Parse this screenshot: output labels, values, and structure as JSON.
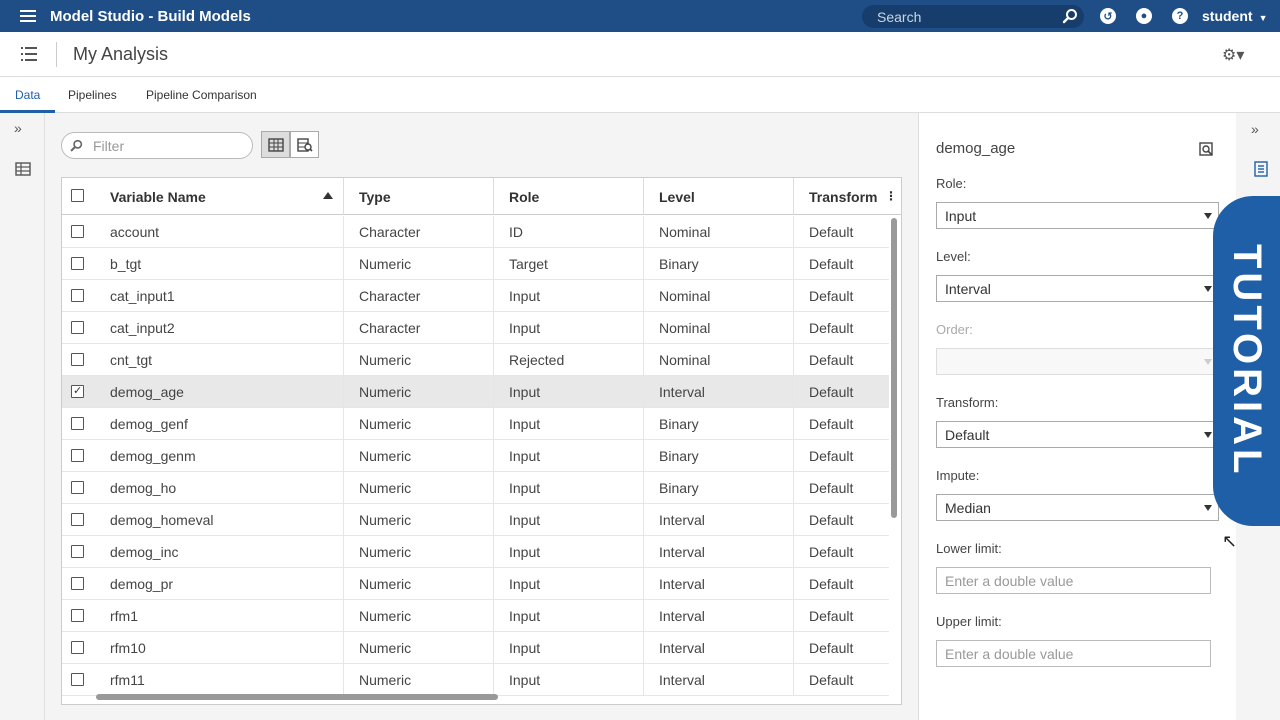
{
  "topbar": {
    "app_title": "Model Studio - Build Models",
    "search_placeholder": "Search",
    "user": "student"
  },
  "subbar": {
    "analysis_title": "My Analysis"
  },
  "tabs": [
    {
      "label": "Data"
    },
    {
      "label": "Pipelines"
    },
    {
      "label": "Pipeline Comparison"
    }
  ],
  "filter": {
    "placeholder": "Filter"
  },
  "table": {
    "columns": [
      "Variable Name",
      "Type",
      "Role",
      "Level",
      "Transform"
    ],
    "rows": [
      {
        "name": "account",
        "type": "Character",
        "role": "ID",
        "level": "Nominal",
        "transform": "Default",
        "checked": false
      },
      {
        "name": "b_tgt",
        "type": "Numeric",
        "role": "Target",
        "level": "Binary",
        "transform": "Default",
        "checked": false
      },
      {
        "name": "cat_input1",
        "type": "Character",
        "role": "Input",
        "level": "Nominal",
        "transform": "Default",
        "checked": false
      },
      {
        "name": "cat_input2",
        "type": "Character",
        "role": "Input",
        "level": "Nominal",
        "transform": "Default",
        "checked": false
      },
      {
        "name": "cnt_tgt",
        "type": "Numeric",
        "role": "Rejected",
        "level": "Nominal",
        "transform": "Default",
        "checked": false
      },
      {
        "name": "demog_age",
        "type": "Numeric",
        "role": "Input",
        "level": "Interval",
        "transform": "Default",
        "checked": true
      },
      {
        "name": "demog_genf",
        "type": "Numeric",
        "role": "Input",
        "level": "Binary",
        "transform": "Default",
        "checked": false
      },
      {
        "name": "demog_genm",
        "type": "Numeric",
        "role": "Input",
        "level": "Binary",
        "transform": "Default",
        "checked": false
      },
      {
        "name": "demog_ho",
        "type": "Numeric",
        "role": "Input",
        "level": "Binary",
        "transform": "Default",
        "checked": false
      },
      {
        "name": "demog_homeval",
        "type": "Numeric",
        "role": "Input",
        "level": "Interval",
        "transform": "Default",
        "checked": false
      },
      {
        "name": "demog_inc",
        "type": "Numeric",
        "role": "Input",
        "level": "Interval",
        "transform": "Default",
        "checked": false
      },
      {
        "name": "demog_pr",
        "type": "Numeric",
        "role": "Input",
        "level": "Interval",
        "transform": "Default",
        "checked": false
      },
      {
        "name": "rfm1",
        "type": "Numeric",
        "role": "Input",
        "level": "Interval",
        "transform": "Default",
        "checked": false
      },
      {
        "name": "rfm10",
        "type": "Numeric",
        "role": "Input",
        "level": "Interval",
        "transform": "Default",
        "checked": false
      },
      {
        "name": "rfm11",
        "type": "Numeric",
        "role": "Input",
        "level": "Interval",
        "transform": "Default",
        "checked": false
      }
    ]
  },
  "properties": {
    "title": "demog_age",
    "role_label": "Role:",
    "role_value": "Input",
    "level_label": "Level:",
    "level_value": "Interval",
    "order_label": "Order:",
    "order_value": "",
    "transform_label": "Transform:",
    "transform_value": "Default",
    "impute_label": "Impute:",
    "impute_value": "Median",
    "lower_label": "Lower limit:",
    "lower_placeholder": "Enter a double value",
    "upper_label": "Upper limit:",
    "upper_placeholder": "Enter a double value"
  },
  "tutorial_badge": "TUTORIAL",
  "colors": {
    "topbar": "#1f4e86",
    "accent": "#1f5fa8"
  }
}
